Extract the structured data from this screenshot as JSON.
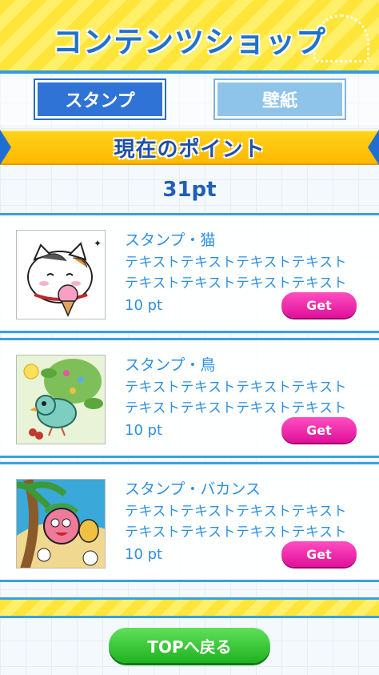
{
  "header": {
    "title": "コンテンツショップ"
  },
  "tabs": [
    {
      "label": "スタンプ",
      "active": true
    },
    {
      "label": "壁紙",
      "active": false
    }
  ],
  "points": {
    "title": "現在のポイント",
    "value": "31pt"
  },
  "items": [
    {
      "name": "スタンプ・猫",
      "desc_line1": "テキストテキストテキストテキスト",
      "desc_line2": "テキストテキストテキストテキスト",
      "price": "10 pt",
      "button": "Get",
      "thumb_icon": "cat-icecream-sticker"
    },
    {
      "name": "スタンプ・鳥",
      "desc_line1": "テキストテキストテキストテキスト",
      "desc_line2": "テキストテキストテキストテキスト",
      "price": "10 pt",
      "button": "Get",
      "thumb_icon": "bird-sticker"
    },
    {
      "name": "スタンプ・バカンス",
      "desc_line1": "テキストテキストテキストテキスト",
      "desc_line2": "テキストテキストテキストテキスト",
      "price": "10 pt",
      "button": "Get",
      "thumb_icon": "vacation-sticker"
    }
  ],
  "footer": {
    "top_button": "TOPへ戻る"
  },
  "colors": {
    "accent_blue": "#2f8fe0",
    "header_yellow": "#ffe53a",
    "get_pink": "#e0109a",
    "top_green": "#1fb21f"
  }
}
